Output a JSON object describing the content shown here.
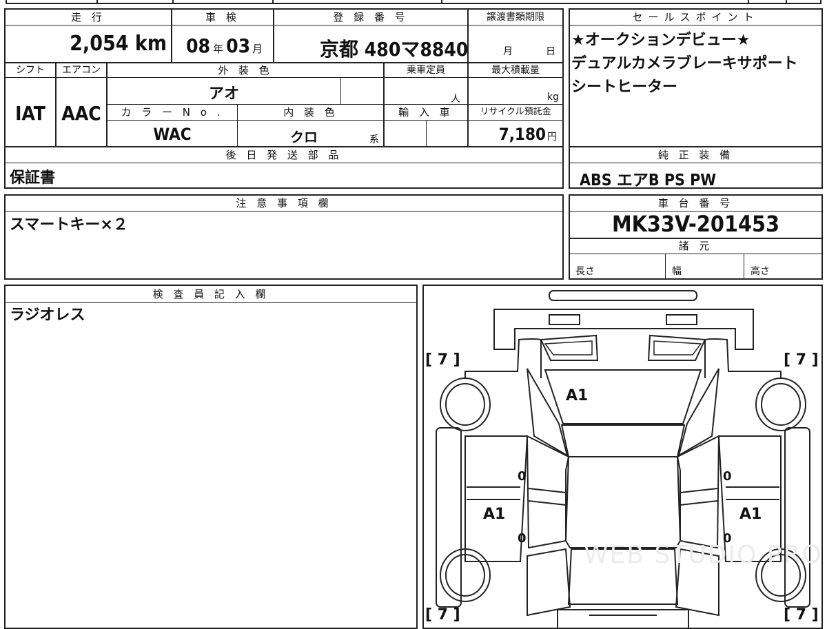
{
  "labels": {
    "mileage": "走 行",
    "inspection": "車 検",
    "registration": "登 録 番 号",
    "transfer_deadline": "譲渡書類期限",
    "sales_points": "セールスポイント",
    "shift": "シフト",
    "aircon": "エアコン",
    "exterior_color": "外 装 色",
    "seating": "乗車定員",
    "max_load": "最大積載量",
    "color_no": "カ ラ ー N o .",
    "interior_color": "内 装 色",
    "import": "輸 入 車",
    "recycle_fee": "リサイクル預託金",
    "later_parts": "後 日 発 送 部 品",
    "genuine_equipment": "純 正 装 備",
    "notes": "注 意 事 項 欄",
    "chassis_no": "車 台 番 号",
    "specs": "諸 元",
    "length": "長さ",
    "width": "幅",
    "height": "高さ",
    "inspector": "検 査 員 記 入 欄"
  },
  "values": {
    "mileage": "2,054",
    "mileage_unit": "km",
    "inspection_year": "08",
    "year_unit": "年",
    "inspection_month": "03",
    "month_unit": "月",
    "registration": "京都 480マ8840",
    "deadline_month_unit": "月",
    "deadline_day_unit": "日",
    "shift": "IAT",
    "aircon": "AAC",
    "exterior_color": "アオ",
    "seating_unit": "人",
    "load_unit": "kg",
    "color_no": "WAC",
    "interior_color": "クロ",
    "interior_suffix": "系",
    "recycle_fee": "7,180",
    "yen_unit": "円",
    "later_parts": "保証書",
    "genuine_equipment": "ABS エアB PS PW",
    "notes": "スマートキー×２",
    "chassis_no": "MK33V-201453",
    "inspector_note": "ラジオレス"
  },
  "sales_points": [
    "★オークションデビュー★",
    "デュアルカメラブレーキサポート",
    "シートヒーター"
  ],
  "diagram": {
    "tire_tread": "[ 7 ]",
    "windshield": "A1",
    "front_left_door": "0",
    "front_right_door": "0",
    "rear_left_door": "A1",
    "rear_right_door": "A1",
    "rear_left_lower": "0",
    "rear_right_lower": "0",
    "watermark": "WEB STUDIO PRO"
  }
}
